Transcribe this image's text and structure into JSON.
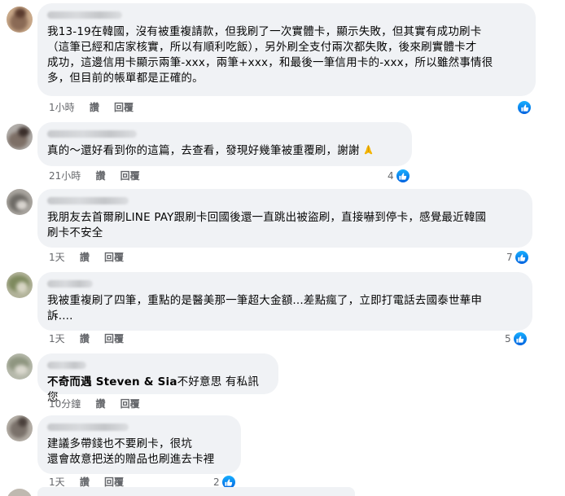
{
  "labels": {
    "read": "讚",
    "reply": "回覆"
  },
  "colors": {
    "bubble": "#f0f2f5",
    "meta": "#65676b",
    "like_blue": "#0866ff"
  },
  "comments": [
    {
      "text": "我13-19在韓國，沒有被重複請款，但我刷了一次實體卡，顯示失敗，但其實有成功刷卡\n（這筆已經和店家核實，所以有順利吃飯），另外刷全支付兩次都失敗，後來刷實體卡才\n成功，這邊信用卡顯示兩筆-xxx，兩筆+xxx，和最後一筆信用卡的-xxx，所以雖然事情很\n多，但目前的帳單都是正確的。",
      "time": "1小時",
      "reactions": "",
      "reaction_icon": "like-icon"
    },
    {
      "text": "真的～還好看到你的這篇，去查看，發現好幾筆被重覆刷，謝謝",
      "emoji": "folded-hands-icon",
      "time": "21小時",
      "reactions": "4",
      "reaction_icon": "like-icon"
    },
    {
      "text": "我朋友去首爾刷LINE PAY跟刷卡回國後還一直跳出被盜刷，直接嚇到停卡，感覺最近韓國\n刷卡不安全",
      "time": "1天",
      "reactions": "7",
      "reaction_icon": "like-icon"
    },
    {
      "text": "我被重複刷了四筆，重點的是醫美那一筆超大金額...差點瘋了，立即打電話去國泰世華申\n訴....",
      "time": "1天",
      "reactions": "5",
      "reaction_icon": "like-icon"
    },
    {
      "tag": "不奇而遇 Steven & Sia",
      "text": "不好意思 有私訊您",
      "time": "10分鐘",
      "reactions": "",
      "reaction_icon": ""
    },
    {
      "text": "建議多帶錢也不要刷卡，很坑\n還會故意把送的贈品也刷進去卡裡",
      "time": "1天",
      "reactions": "2",
      "reaction_icon": "like-icon"
    }
  ]
}
